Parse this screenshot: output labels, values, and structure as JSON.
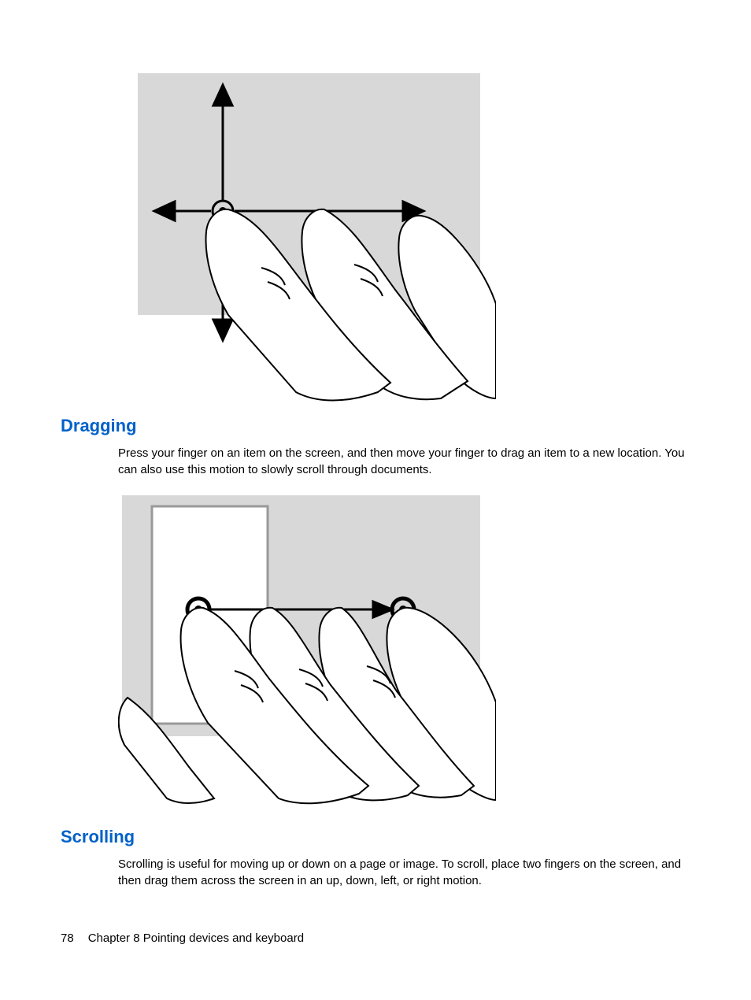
{
  "sections": {
    "dragging": {
      "heading": "Dragging",
      "body": "Press your finger on an item on the screen, and then move your finger to drag an item to a new location. You can also use this motion to slowly scroll through documents."
    },
    "scrolling": {
      "heading": "Scrolling",
      "body": "Scrolling is useful for moving up or down on a page or image. To scroll, place two fingers on the screen, and then drag them across the screen in an up, down, left, or right motion."
    }
  },
  "footer": {
    "page_number": "78",
    "chapter_label": "Chapter 8   Pointing devices and keyboard"
  },
  "colors": {
    "heading_blue": "#0061c8",
    "touch_bg": "#d8d8d8"
  }
}
